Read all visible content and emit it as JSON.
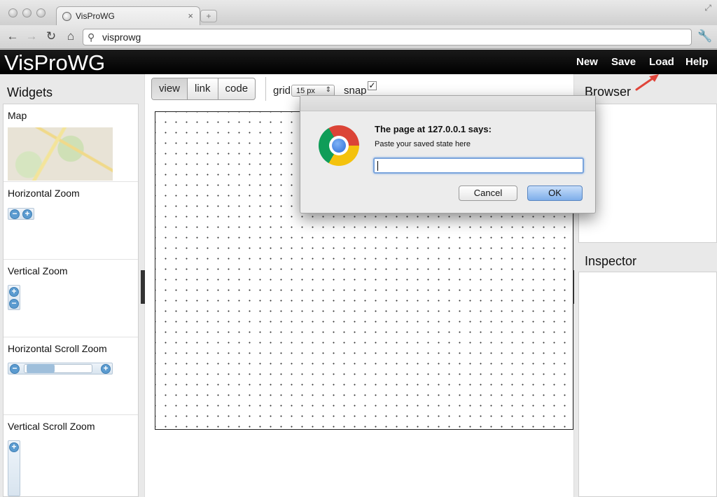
{
  "browser": {
    "tab_title": "VisProWG",
    "tab_close": "×",
    "new_tab": "+",
    "address": "visprowg",
    "nav": {
      "back": "←",
      "forward": "→",
      "reload": "↻",
      "home": "⌂"
    }
  },
  "app": {
    "brand": "VisProWG",
    "menu": [
      "New",
      "Save",
      "Load",
      "Help"
    ]
  },
  "widgets_panel": {
    "title": "Widgets",
    "items": [
      {
        "label": "Map"
      },
      {
        "label": "Horizontal Zoom"
      },
      {
        "label": "Vertical Zoom"
      },
      {
        "label": "Horizontal Scroll Zoom"
      },
      {
        "label": "Vertical Scroll Zoom"
      }
    ]
  },
  "toolbar": {
    "modes": [
      "view",
      "link",
      "code"
    ],
    "active_mode": "view",
    "grid_label": "grid",
    "grid_value": "15 px",
    "snap_label": "snap",
    "snap_checked": true
  },
  "browser_panel": {
    "title": "Browser"
  },
  "inspector_panel": {
    "title": "Inspector"
  },
  "dialog": {
    "title": "The page at 127.0.0.1 says:",
    "message": "Paste your saved state here",
    "input_value": "",
    "cancel_label": "Cancel",
    "ok_label": "OK"
  },
  "colors": {
    "appbar": "#000000",
    "ok_button": "#7eaeea",
    "zoom_button": "#5b9bd0",
    "annotation_arrow": "#e0453a"
  }
}
